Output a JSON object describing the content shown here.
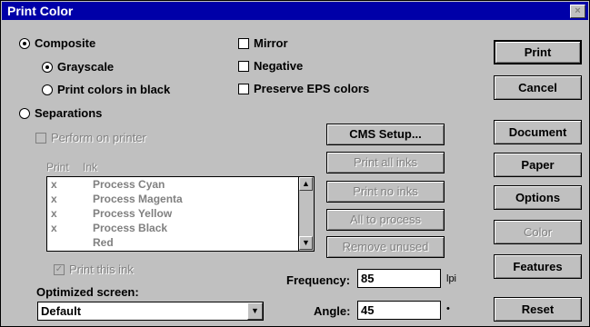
{
  "window": {
    "title": "Print Color",
    "close_label": "×"
  },
  "options": {
    "composite": "Composite",
    "grayscale": "Grayscale",
    "print_black": "Print colors in black",
    "separations": "Separations",
    "perform_on_printer": "Perform on printer",
    "mirror": "Mirror",
    "negative": "Negative",
    "preserve_eps": "Preserve EPS colors"
  },
  "list": {
    "header_print": "Print",
    "header_ink": "Ink",
    "rows": [
      {
        "print": "x",
        "ink": "Process Cyan"
      },
      {
        "print": "x",
        "ink": "Process Magenta"
      },
      {
        "print": "x",
        "ink": "Process Yellow"
      },
      {
        "print": "x",
        "ink": "Process Black"
      },
      {
        "print": "",
        "ink": "Red"
      }
    ],
    "print_this_ink": "Print this ink"
  },
  "mid_buttons": {
    "cms_setup": "CMS Setup...",
    "print_all_inks": "Print all inks",
    "print_no_inks": "Print no inks",
    "all_to_process": "All to process",
    "remove_unused": "Remove unused"
  },
  "screen": {
    "optimized_label": "Optimized screen:",
    "selected": "Default",
    "frequency_label": "Frequency:",
    "frequency_value": "85",
    "frequency_unit": "lpi",
    "angle_label": "Angle:",
    "angle_value": "45",
    "angle_unit": "•"
  },
  "right_buttons": {
    "print": "Print",
    "cancel": "Cancel",
    "document": "Document",
    "paper": "Paper",
    "options": "Options",
    "color": "Color",
    "features": "Features",
    "reset": "Reset"
  }
}
